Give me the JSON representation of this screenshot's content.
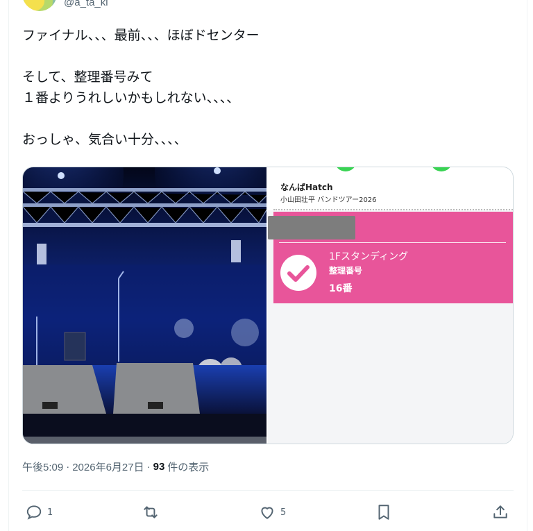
{
  "author": {
    "handle": "@a_ta_ki"
  },
  "tweet": {
    "lines": [
      "ファイナル、、、最前、、、ほぼドセンター",
      "",
      "そして、整理番号みて",
      "１番よりうれしいかもしれない、、、、",
      "",
      "おっしゃ、気合い十分、、、、"
    ]
  },
  "ticket": {
    "venue": "なんばHatch",
    "tour": "小山田壮平 バンドツアー2026",
    "area": "1Fスタンディング",
    "number_label": "整理番号",
    "number": "16番"
  },
  "meta": {
    "time": "午後5:09",
    "sep": "·",
    "date": "2026年6月27日",
    "views": "93",
    "views_label": "件の表示"
  },
  "actions": {
    "reply_count": "1",
    "retweet_count": "",
    "like_count": "5"
  },
  "colors": {
    "pink": "#e8559a",
    "green": "#39d353",
    "muted": "#536471"
  }
}
